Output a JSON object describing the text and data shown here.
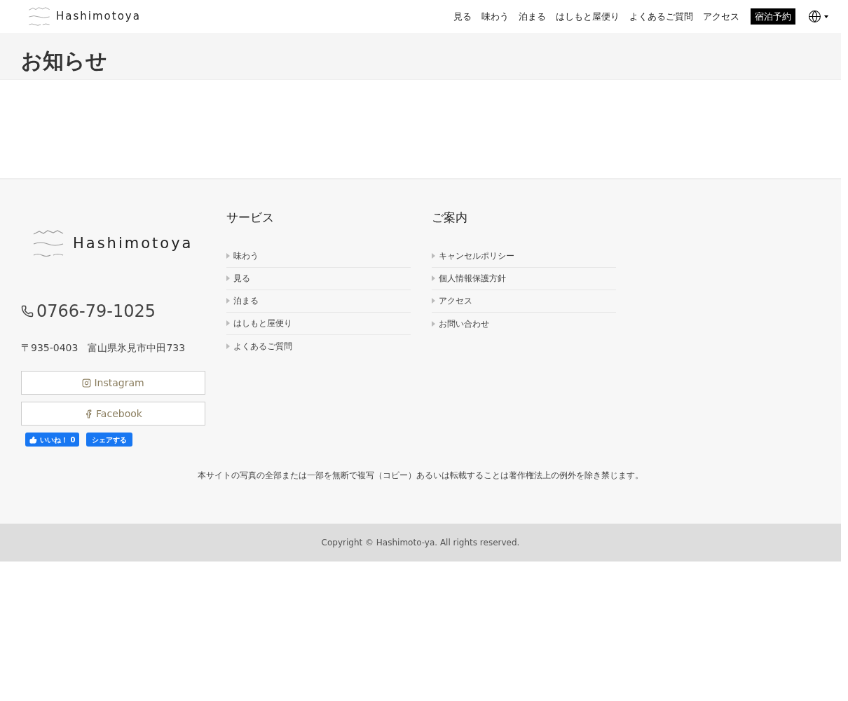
{
  "header": {
    "logo": "Hashimotoya",
    "nav": [
      "見る",
      "味わう",
      "泊まる",
      "はしもと屋便り",
      "よくあるご質問",
      "アクセス"
    ],
    "reserve_button": "宿泊予約"
  },
  "page_title": "お知らせ",
  "footer": {
    "logo": "Hashimotoya",
    "phone": "0766-79-1025",
    "address": "〒935-0403　富山県氷見市中田733",
    "social_buttons": [
      {
        "kind": "instagram",
        "label": "Instagram"
      },
      {
        "kind": "facebook",
        "label": "Facebook"
      }
    ],
    "like_button": "いいね！ 0",
    "share_button": "シェアする",
    "columns": [
      {
        "title": "サービス",
        "links": [
          "味わう",
          "見る",
          "泊まる",
          "はしもと屋便り",
          "よくあるご質問"
        ]
      },
      {
        "title": "ご案内",
        "links": [
          "キャンセルポリシー",
          "個人情報保護方針",
          "アクセス",
          "お問い合わせ"
        ]
      }
    ],
    "notice": "本サイトの写真の全部または一部を無断で複写（コピー）あるいは転載することは著作権法上の例外を除き禁じます。",
    "copyright": "Copyright © Hashimoto-ya. All rights reserved."
  }
}
